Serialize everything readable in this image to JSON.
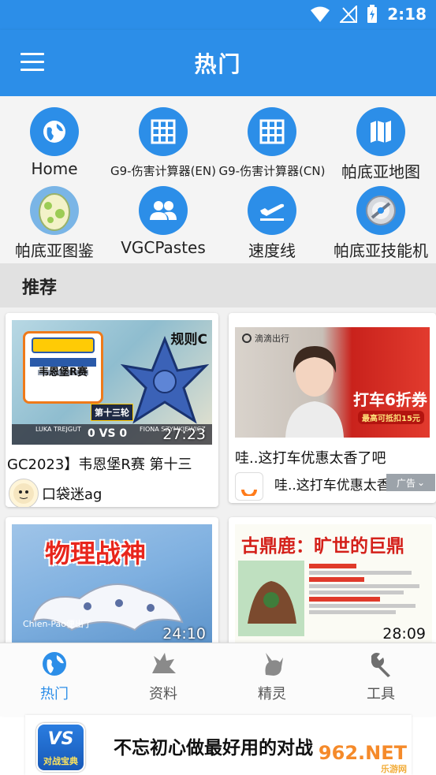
{
  "status": {
    "time": "2:18"
  },
  "appbar": {
    "title": "热门"
  },
  "shortcuts": [
    {
      "label": "Home",
      "icon": "globe-icon"
    },
    {
      "label": "G9-伤害计算器(EN)",
      "icon": "grid-icon"
    },
    {
      "label": "G9-伤害计算器(CN)",
      "icon": "grid-icon"
    },
    {
      "label": "帕底亚地图",
      "icon": "map-icon"
    },
    {
      "label": "帕底亚图鉴",
      "icon": "egg-icon"
    },
    {
      "label": "VGCPastes",
      "icon": "people-icon"
    },
    {
      "label": "速度线",
      "icon": "plane-icon"
    },
    {
      "label": "帕底亚技能机",
      "icon": "disc-icon"
    }
  ],
  "section": {
    "title": "推荐"
  },
  "feed": {
    "card1": {
      "badge_rule": "规则C",
      "badge_championship": "韦恩堡R赛",
      "badge_round": "第十三轮",
      "score_left": "LUKA TREJGUT",
      "score_vs": "0 VS 0",
      "score_right": "FIONA SZYMKIEWICZ",
      "duration": "27:23",
      "title": "GC2023】韦恩堡R赛 第十三",
      "author": "口袋迷ag"
    },
    "card2": {
      "brand": "滴滴出行",
      "promo": "打车6折券",
      "promo_sub": "最高可抵扣15元",
      "title": "哇..这打车优惠太香了吧",
      "subtitle": "哇..这打车优惠太香了吧",
      "ad_label": "广告"
    },
    "card3": {
      "headline": "物理战神",
      "caption": "Chien-Pao便出了",
      "duration": "24:10"
    },
    "card4": {
      "headline": "古鼎鹿：旷世的巨鼎",
      "duration": "28:09"
    }
  },
  "nav": {
    "items": [
      {
        "label": "热门",
        "icon": "globe-icon"
      },
      {
        "label": "资料",
        "icon": "pokemon-silhouette-icon"
      },
      {
        "label": "精灵",
        "icon": "pikachu-icon"
      },
      {
        "label": "工具",
        "icon": "wrench-icon"
      }
    ]
  },
  "ad": {
    "logo_text": "VS",
    "logo_sub": "对战宝典",
    "text": "不忘初心做最好用的对战",
    "watermark": "962.NET",
    "watermark_sub": "乐游网"
  },
  "colors": {
    "primary": "#2c8ee8",
    "section_bg": "#e1e1e1",
    "feed_bg": "#f1f1f1"
  }
}
